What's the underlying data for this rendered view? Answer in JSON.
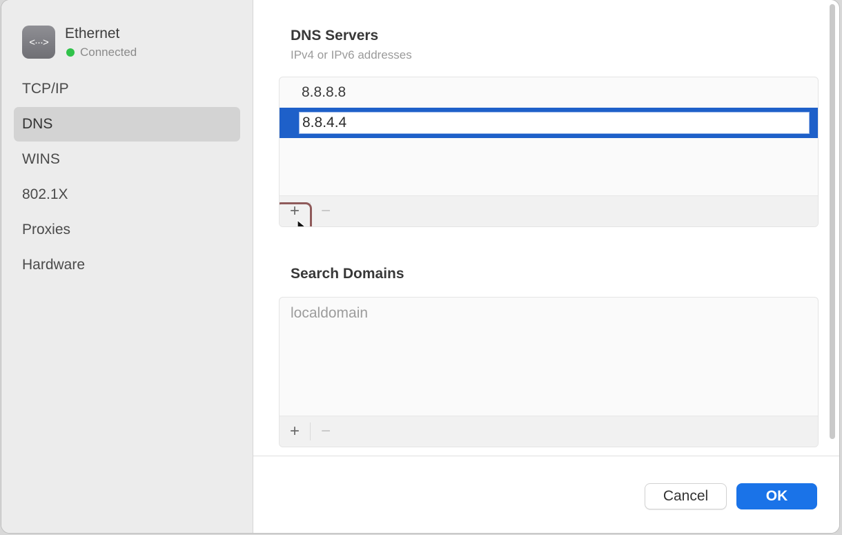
{
  "connection": {
    "name": "Ethernet",
    "status": "Connected",
    "icon": "ethernet-icon",
    "status_color": "#30c24a"
  },
  "sidebar": {
    "items": [
      {
        "label": "TCP/IP",
        "selected": false
      },
      {
        "label": "DNS",
        "selected": true
      },
      {
        "label": "WINS",
        "selected": false
      },
      {
        "label": "802.1X",
        "selected": false
      },
      {
        "label": "Proxies",
        "selected": false
      },
      {
        "label": "Hardware",
        "selected": false
      }
    ]
  },
  "dns": {
    "title": "DNS Servers",
    "subtitle": "IPv4 or IPv6 addresses",
    "servers": [
      "8.8.8.8",
      "8.8.4.4"
    ],
    "add_label": "+",
    "remove_label": "−"
  },
  "search_domains": {
    "title": "Search Domains",
    "placeholder": "localdomain",
    "add_label": "+",
    "remove_label": "−"
  },
  "footer": {
    "cancel_label": "Cancel",
    "ok_label": "OK"
  },
  "colors": {
    "accent": "#1a73e8",
    "selection": "#1e60c9",
    "highlight_ring": "#8f5a5a"
  }
}
